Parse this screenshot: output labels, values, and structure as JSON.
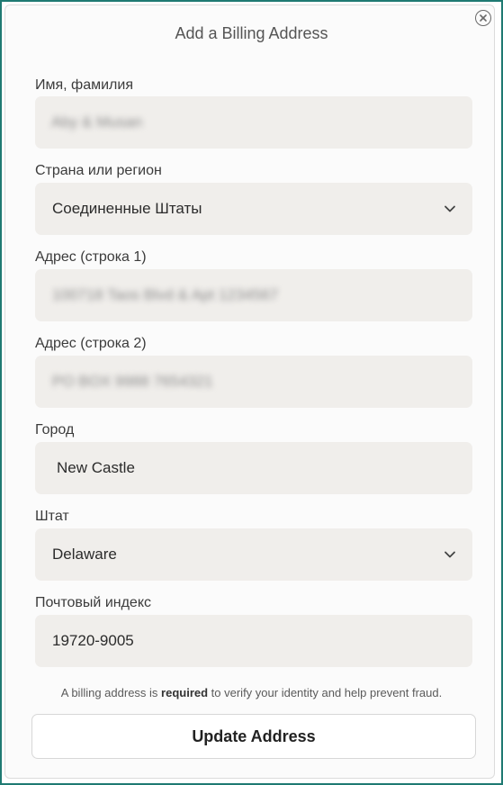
{
  "dialog": {
    "title": "Add a Billing Address",
    "close_icon": "close-circle-icon"
  },
  "fields": {
    "full_name": {
      "label": "Имя, фамилия",
      "value": "Aby & Musan"
    },
    "country": {
      "label": "Страна или регион",
      "value": "Соединенные Штаты",
      "icon": "chevron-down-icon"
    },
    "address1": {
      "label": "Адрес (строка 1)",
      "value": "100718 Taos Blvd & Apt 1234567"
    },
    "address2": {
      "label": "Адрес (строка 2)",
      "value": "PO BOX 9988 7654321"
    },
    "city": {
      "label": "Город",
      "value": "New Castle"
    },
    "state": {
      "label": "Штат",
      "value": "Delaware",
      "icon": "chevron-down-icon"
    },
    "zip": {
      "label": "Почтовый индекс",
      "value": "19720-9005"
    }
  },
  "note": {
    "prefix": "A billing address is ",
    "bold": "required",
    "suffix": " to verify your identity and help prevent fraud."
  },
  "actions": {
    "update_label": "Update Address"
  },
  "colors": {
    "frame_border": "#1f7a72",
    "field_background": "#f0eeeb",
    "dialog_background": "#fbfbfb"
  }
}
